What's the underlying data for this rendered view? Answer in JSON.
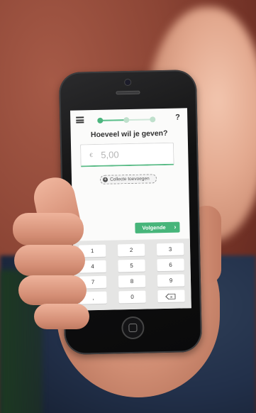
{
  "app": {
    "title": "Hoeveel wil je geven?",
    "help_label": "?",
    "steps": {
      "current": 1,
      "total": 3
    },
    "amount": {
      "currency_symbol": "€",
      "placeholder_value": "5,00"
    },
    "collecte_button": {
      "plus_symbol": "+",
      "label": "Collecte toevoegen"
    },
    "next_button": {
      "label": "Volgende",
      "chevron": "›"
    },
    "keypad": {
      "keys": [
        "1",
        "2",
        "3",
        "4",
        "5",
        "6",
        "7",
        "8",
        "9",
        ",",
        "0"
      ],
      "backspace_symbol": "×"
    },
    "colors": {
      "accent": "#47b57a",
      "step_inactive": "#bfe0cc",
      "keypad_bg": "#e5e5e4"
    }
  }
}
